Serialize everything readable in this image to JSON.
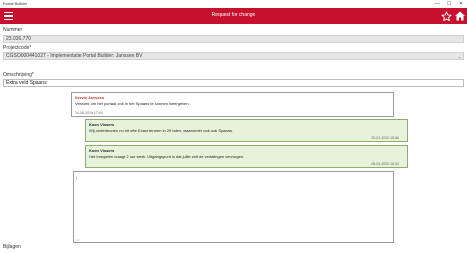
{
  "window": {
    "title": "Portal Builder"
  },
  "appbar": {
    "title": "Request for change",
    "accent": "#c8102e"
  },
  "form": {
    "number_label": "Nummer",
    "number_value": "23.036.770",
    "project_label": "Projectcode*",
    "project_value": "CGSO000441027 - Implementatie Portal Builder: Janssen BV",
    "description_label": "Omschrijving*",
    "description_value": "Extra veld Spaans",
    "attachments_label": "Bijlagen"
  },
  "messages": [
    {
      "author": "Servie Janssen",
      "text": "Verzoek om het portaal ook in het Spaans te kunnen weergeven.",
      "time": "14-06-2019 17:04",
      "side": "left"
    },
    {
      "author": "Koen Vissers",
      "text": "Wij onderteunen nu nit ofte Exact termen in 29 talen, waaronder ook ook Spaans.",
      "time": "20-01-2020 15:56",
      "side": "right"
    },
    {
      "author": "Koen Vissers",
      "text": "Het Inregelen vraagt 2 uur werk. Uitgangspunt is dat jullie zelf de vertalingen verzorgen.",
      "time": "06-04-2020 16:32",
      "side": "right"
    }
  ],
  "compose": {
    "cursor_glyph": "|",
    "resize_glyph": "⌞⌟"
  },
  "icons": {
    "menu": "hamburger-icon",
    "star": "star-icon",
    "home": "home-icon",
    "chevron": "chevron-down-icon"
  }
}
